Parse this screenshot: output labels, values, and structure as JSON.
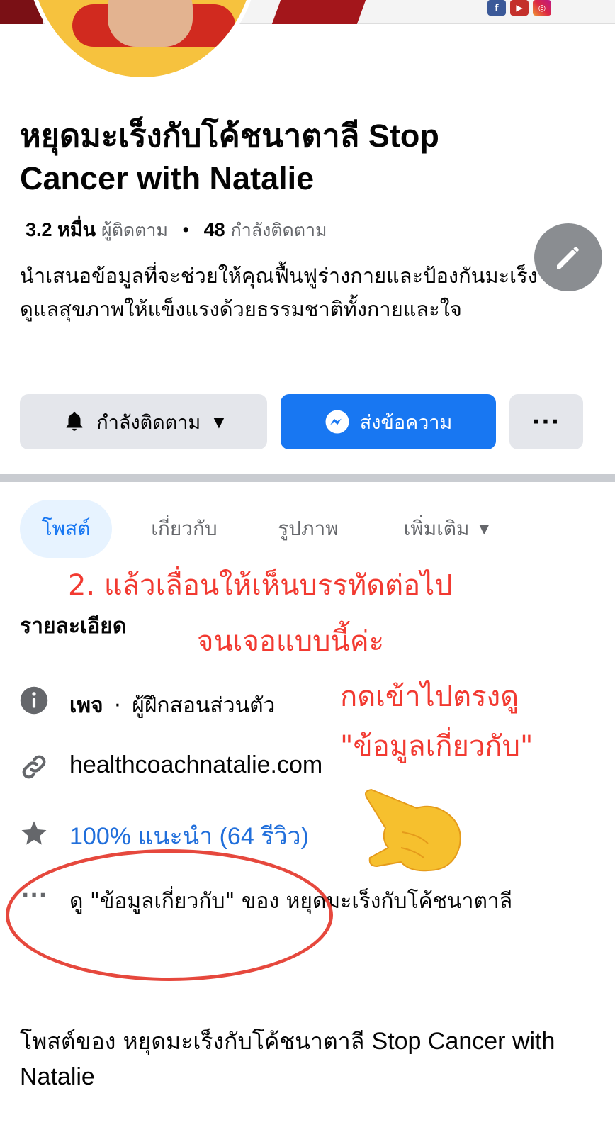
{
  "banner": {
    "social_icons": [
      "facebook-icon",
      "youtube-icon",
      "instagram-icon"
    ],
    "colors": {
      "banner_red": "#a3161b",
      "profile_yellow": "#f6c23e"
    }
  },
  "page": {
    "title": "หยุดมะเร็งกับโค้ชนาตาลี Stop Cancer with Natalie",
    "followers_count": "3.2 หมื่น",
    "followers_label": "ผู้ติดตาม",
    "stats_separator": "•",
    "following_count": "48",
    "following_label": "กำลังติดตาม",
    "bio": "นำเสนอข้อมูลที่จะช่วยให้คุณฟื้นฟูร่างกายและป้องกันมะเร็ง ดูแลสุขภาพให้แข็งแรงด้วยธรรมชาติทั้งกายและใจ"
  },
  "actions": {
    "following_label": "กำลังติดตาม",
    "message_label": "ส่งข้อความ",
    "more_label": "···"
  },
  "tabs": [
    {
      "label": "โพสต์",
      "active": true
    },
    {
      "label": "เกี่ยวกับ",
      "active": false
    },
    {
      "label": "รูปภาพ",
      "active": false
    },
    {
      "label": "เพิ่มเติม",
      "active": false
    }
  ],
  "annotation": {
    "line1": "2. แล้วเลื่อนให้เห็นบรรทัดต่อไป",
    "line2": "จนเจอแบบนี้ค่ะ",
    "line3": "กดเข้าไปตรงดู",
    "line4": "\"ข้อมูลเกี่ยวกับ\"",
    "color": "#f23a31"
  },
  "details": {
    "title": "รายละเอียด",
    "category_type": "เพจ",
    "category_sep": "·",
    "category_value": "ผู้ฝึกสอนส่วนตัว",
    "website": "healthcoachnatalie.com",
    "rating": "100% แนะนำ (64 รีวิว)",
    "more_dots": "···",
    "about_link": "ดู \"ข้อมูลเกี่ยวกับ\" ของ หยุดมะเร็งกับโค้ชนาตาลี"
  },
  "posts": {
    "prefix": "โพสต์ของ หยุดมะเร็งกับโค้ชนาตาลี",
    "suffix": "Stop Cancer with Natalie"
  },
  "colors": {
    "primary_blue": "#1877f2",
    "link_blue": "#216fdb",
    "secondary_gray": "#65676b",
    "button_gray": "#e4e6eb"
  }
}
